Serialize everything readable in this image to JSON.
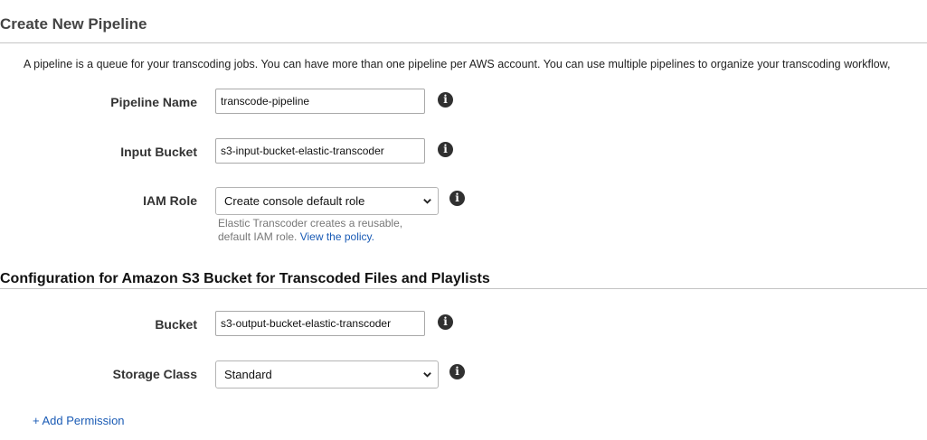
{
  "page": {
    "title": "Create New Pipeline",
    "intro": "A pipeline is a queue for your transcoding jobs. You can have more than one pipeline per AWS account. You can use multiple pipelines to organize your transcoding workflow,"
  },
  "form": {
    "pipeline_name": {
      "label": "Pipeline Name",
      "value": "transcode-pipeline"
    },
    "input_bucket": {
      "label": "Input Bucket",
      "value": "s3-input-bucket-elastic-transcoder"
    },
    "iam_role": {
      "label": "IAM Role",
      "selected": "Create console default role",
      "help": "Elastic Transcoder creates a reusable, default IAM role.",
      "help_link": "View the policy."
    }
  },
  "output_config": {
    "title": "Configuration for Amazon S3 Bucket for Transcoded Files and Playlists",
    "bucket": {
      "label": "Bucket",
      "value": "s3-output-bucket-elastic-transcoder"
    },
    "storage_class": {
      "label": "Storage Class",
      "selected": "Standard"
    },
    "add_permission": "+ Add Permission"
  },
  "icons": {
    "info": "info-icon",
    "chevron": "chevron-down-icon"
  },
  "colors": {
    "link": "#1a5bb5",
    "info_icon_bg": "#303030",
    "rule": "#c4c4c4"
  }
}
